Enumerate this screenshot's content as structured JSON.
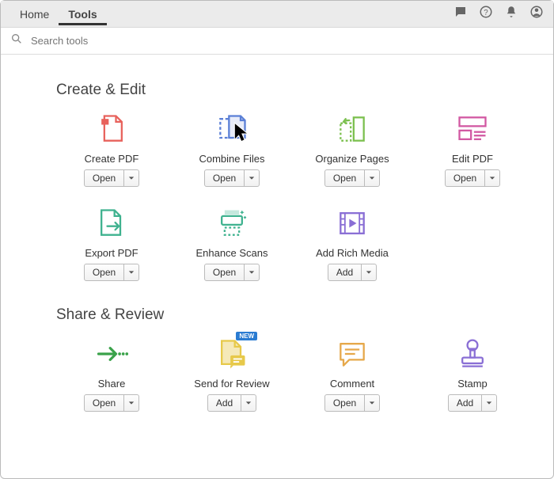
{
  "header": {
    "tabs": [
      {
        "label": "Home",
        "active": false
      },
      {
        "label": "Tools",
        "active": true
      }
    ]
  },
  "search": {
    "placeholder": "Search tools"
  },
  "sections": [
    {
      "title": "Create & Edit",
      "tools": [
        {
          "icon": "create-pdf-icon",
          "label": "Create PDF",
          "button": "Open"
        },
        {
          "icon": "combine-files-icon",
          "label": "Combine Files",
          "button": "Open",
          "cursor": true
        },
        {
          "icon": "organize-pages-icon",
          "label": "Organize Pages",
          "button": "Open"
        },
        {
          "icon": "edit-pdf-icon",
          "label": "Edit PDF",
          "button": "Open"
        },
        {
          "icon": "export-pdf-icon",
          "label": "Export PDF",
          "button": "Open"
        },
        {
          "icon": "enhance-scans-icon",
          "label": "Enhance Scans",
          "button": "Open"
        },
        {
          "icon": "add-rich-media-icon",
          "label": "Add Rich Media",
          "button": "Add"
        }
      ]
    },
    {
      "title": "Share & Review",
      "tools": [
        {
          "icon": "share-icon",
          "label": "Share",
          "button": "Open"
        },
        {
          "icon": "send-for-review-icon",
          "label": "Send for Review",
          "button": "Add",
          "badge": "NEW"
        },
        {
          "icon": "comment-icon",
          "label": "Comment",
          "button": "Open"
        },
        {
          "icon": "stamp-icon",
          "label": "Stamp",
          "button": "Add"
        }
      ]
    }
  ],
  "colors": {
    "red": "#e8625c",
    "blue": "#5a7fd6",
    "green": "#7cc04f",
    "magenta": "#d258a2",
    "teal": "#3fb28f",
    "yellow": "#e7c94a",
    "orange": "#e6a84a",
    "purple": "#8a6fd5",
    "share": "#3aa24a"
  }
}
